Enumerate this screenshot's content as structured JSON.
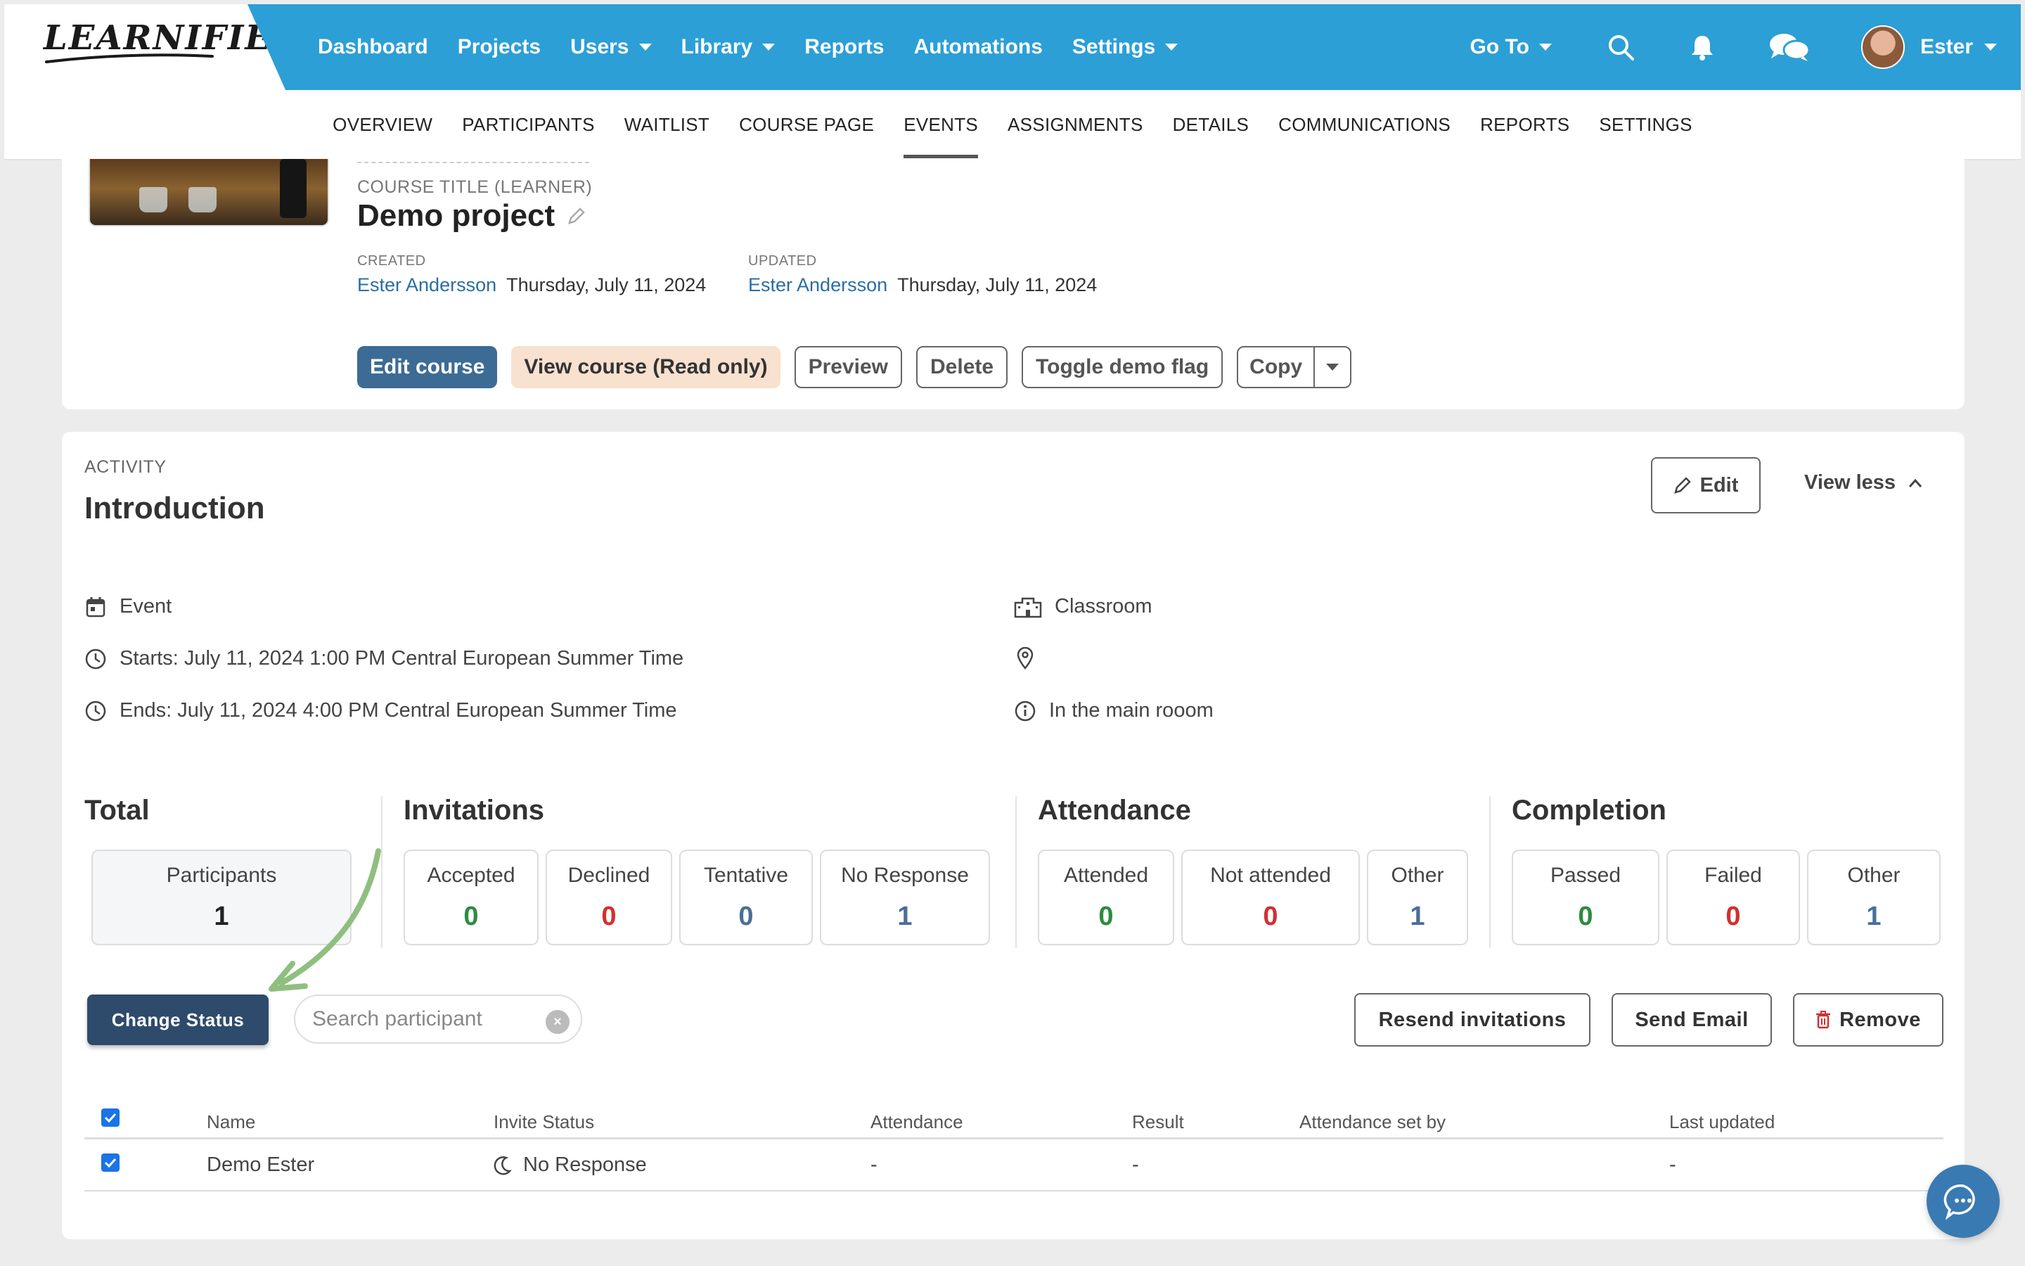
{
  "brand": {
    "logo_text": "LEARNIFIER",
    "nav_bg": "#2c9fd6"
  },
  "nav": {
    "items": [
      {
        "label": "Dashboard",
        "dropdown": false
      },
      {
        "label": "Projects",
        "dropdown": false
      },
      {
        "label": "Users",
        "dropdown": true
      },
      {
        "label": "Library",
        "dropdown": true
      },
      {
        "label": "Reports",
        "dropdown": false
      },
      {
        "label": "Automations",
        "dropdown": false
      },
      {
        "label": "Settings",
        "dropdown": true
      }
    ],
    "goto_label": "Go To",
    "user_name": "Ester",
    "icons": [
      "search-icon",
      "bell-icon",
      "chat-icon"
    ]
  },
  "subnav": {
    "items": [
      "OVERVIEW",
      "PARTICIPANTS",
      "WAITLIST",
      "COURSE PAGE",
      "EVENTS",
      "ASSIGNMENTS",
      "DETAILS",
      "COMMUNICATIONS",
      "REPORTS",
      "SETTINGS"
    ],
    "active": "EVENTS"
  },
  "course": {
    "title_label": "COURSE TITLE (LEARNER)",
    "title": "Demo project",
    "created_label": "CREATED",
    "created_by": "Ester Andersson",
    "created_date": "Thursday, July 11, 2024",
    "updated_label": "UPDATED",
    "updated_by": "Ester Andersson",
    "updated_date": "Thursday, July 11, 2024",
    "actions": {
      "edit": "Edit course",
      "view": "View course (Read only)",
      "preview": "Preview",
      "delete": "Delete",
      "toggle_demo": "Toggle demo flag",
      "copy": "Copy"
    }
  },
  "activity": {
    "label": "ACTIVITY",
    "title": "Introduction",
    "edit_label": "Edit",
    "view_less_label": "View less",
    "type": "Event",
    "starts": "Starts: July 11, 2024 1:00 PM Central European Summer Time",
    "ends": "Ends: July 11, 2024 4:00 PM Central European Summer Time",
    "location_type": "Classroom",
    "address": "",
    "info": "In the main rooom"
  },
  "stats": {
    "total": {
      "heading": "Total",
      "boxes": [
        {
          "label": "Participants",
          "value": "1"
        }
      ]
    },
    "invitations": {
      "heading": "Invitations",
      "boxes": [
        {
          "label": "Accepted",
          "value": "0"
        },
        {
          "label": "Declined",
          "value": "0"
        },
        {
          "label": "Tentative",
          "value": "0"
        },
        {
          "label": "No Response",
          "value": "1"
        }
      ]
    },
    "attendance": {
      "heading": "Attendance",
      "boxes": [
        {
          "label": "Attended",
          "value": "0"
        },
        {
          "label": "Not attended",
          "value": "0"
        },
        {
          "label": "Other",
          "value": "1"
        }
      ]
    },
    "completion": {
      "heading": "Completion",
      "boxes": [
        {
          "label": "Passed",
          "value": "0"
        },
        {
          "label": "Failed",
          "value": "0"
        },
        {
          "label": "Other",
          "value": "1"
        }
      ]
    },
    "colors": {
      "green": "#2e8b3d",
      "red": "#d32f2f",
      "blue": "#4a6f98",
      "dark": "#222222"
    }
  },
  "toolbar": {
    "change_status": "Change Status",
    "search_placeholder": "Search participant",
    "resend": "Resend invitations",
    "send_email": "Send Email",
    "remove": "Remove"
  },
  "table": {
    "headers": [
      "Name",
      "Invite Status",
      "Attendance",
      "Result",
      "Attendance set by",
      "Last updated"
    ],
    "rows": [
      {
        "name": "Demo Ester",
        "invite_status": "No Response",
        "attendance": "-",
        "result": "-",
        "attendance_set_by": "",
        "last_updated": "-"
      }
    ]
  }
}
